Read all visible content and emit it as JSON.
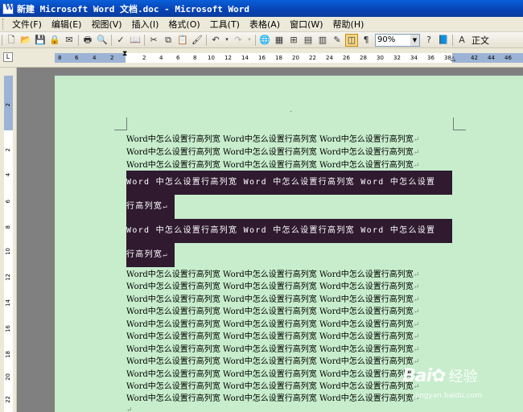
{
  "window": {
    "title": "新建 Microsoft Word 文档.doc - Microsoft Word"
  },
  "menu": [
    "文件(F)",
    "编辑(E)",
    "视图(V)",
    "插入(I)",
    "格式(O)",
    "工具(T)",
    "表格(A)",
    "窗口(W)",
    "帮助(H)"
  ],
  "toolbar": {
    "icons": [
      "new-icon",
      "open-icon",
      "save-icon",
      "permission-icon",
      "email-icon",
      "print-icon",
      "print-preview-icon",
      "spelling-icon",
      "research-icon",
      "cut-icon",
      "copy-icon",
      "paste-icon",
      "format-painter-icon",
      "undo-icon",
      "redo-icon",
      "hyperlink-icon",
      "tables-borders-icon",
      "insert-table-icon",
      "insert-excel-icon",
      "columns-icon",
      "drawing-icon",
      "document-map-icon",
      "show-hide-icon",
      "read-icon",
      "help-icon"
    ],
    "zoom": "90%",
    "style": "正文"
  },
  "ruler": {
    "ticks": [
      "8",
      "6",
      "4",
      "2",
      "2",
      "4",
      "6",
      "8",
      "10",
      "12",
      "14",
      "16",
      "18",
      "20",
      "22",
      "24",
      "26",
      "28",
      "30",
      "32",
      "34",
      "36",
      "38",
      "42",
      "44",
      "46"
    ],
    "vticks": [
      "2",
      "2",
      "4",
      "6",
      "8",
      "10",
      "12",
      "14",
      "16",
      "18",
      "20",
      "22"
    ],
    "tab_selector": "L"
  },
  "document": {
    "line_text": "Word中怎么设置行高列宽 Word中怎么设置行高列宽 Word中怎么设置行高列宽",
    "para_mark": "↵",
    "top_lines": 3,
    "selected_lines": [
      "Word 中怎么设置行高列宽 Word 中怎么设置行高列宽 Word 中怎么设置",
      "行高列宽",
      "Word 中怎么设置行高列宽 Word 中怎么设置行高列宽 Word 中怎么设置",
      "行高列宽"
    ],
    "bottom_lines": 11
  },
  "watermark": {
    "logo": "Bai",
    "logo2": "百",
    "jingyan": "经验",
    "url": "jingyan.baidu.com"
  }
}
